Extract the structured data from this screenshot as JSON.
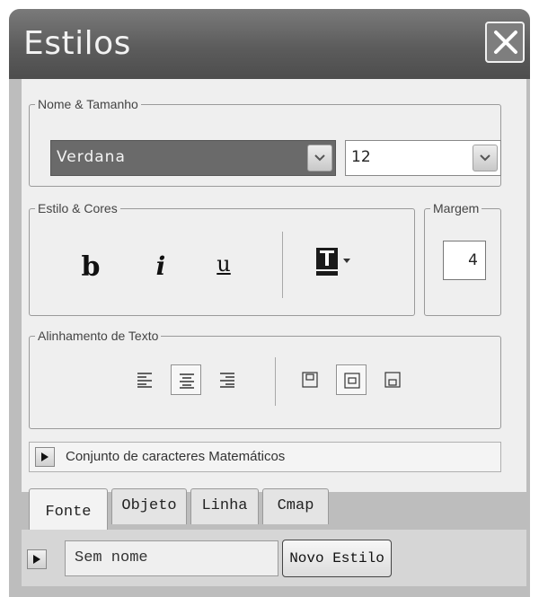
{
  "window": {
    "title": "Estilos"
  },
  "name_size": {
    "legend": "Nome & Tamanho",
    "font_value": "Verdana",
    "size_value": "12"
  },
  "style_colors": {
    "legend": "Estilo & Cores",
    "bold": "b",
    "italic": "i",
    "underline": "u"
  },
  "margin": {
    "legend": "Margem",
    "value": "4"
  },
  "alignment": {
    "legend": "Alinhamento de Texto"
  },
  "math_charset": {
    "label": "Conjunto de caracteres Matemáticos"
  },
  "tabs": [
    {
      "label": "Fonte",
      "active": true
    },
    {
      "label": "Objeto",
      "active": false
    },
    {
      "label": "Linha",
      "active": false
    },
    {
      "label": "Cmap",
      "active": false
    }
  ],
  "footer": {
    "style_name": "Sem nome",
    "new_style_button": "Novo Estilo"
  },
  "colors": {
    "titlebar": "#5c5c5c",
    "panel": "#efefef",
    "selection": "#6a6a6a"
  }
}
